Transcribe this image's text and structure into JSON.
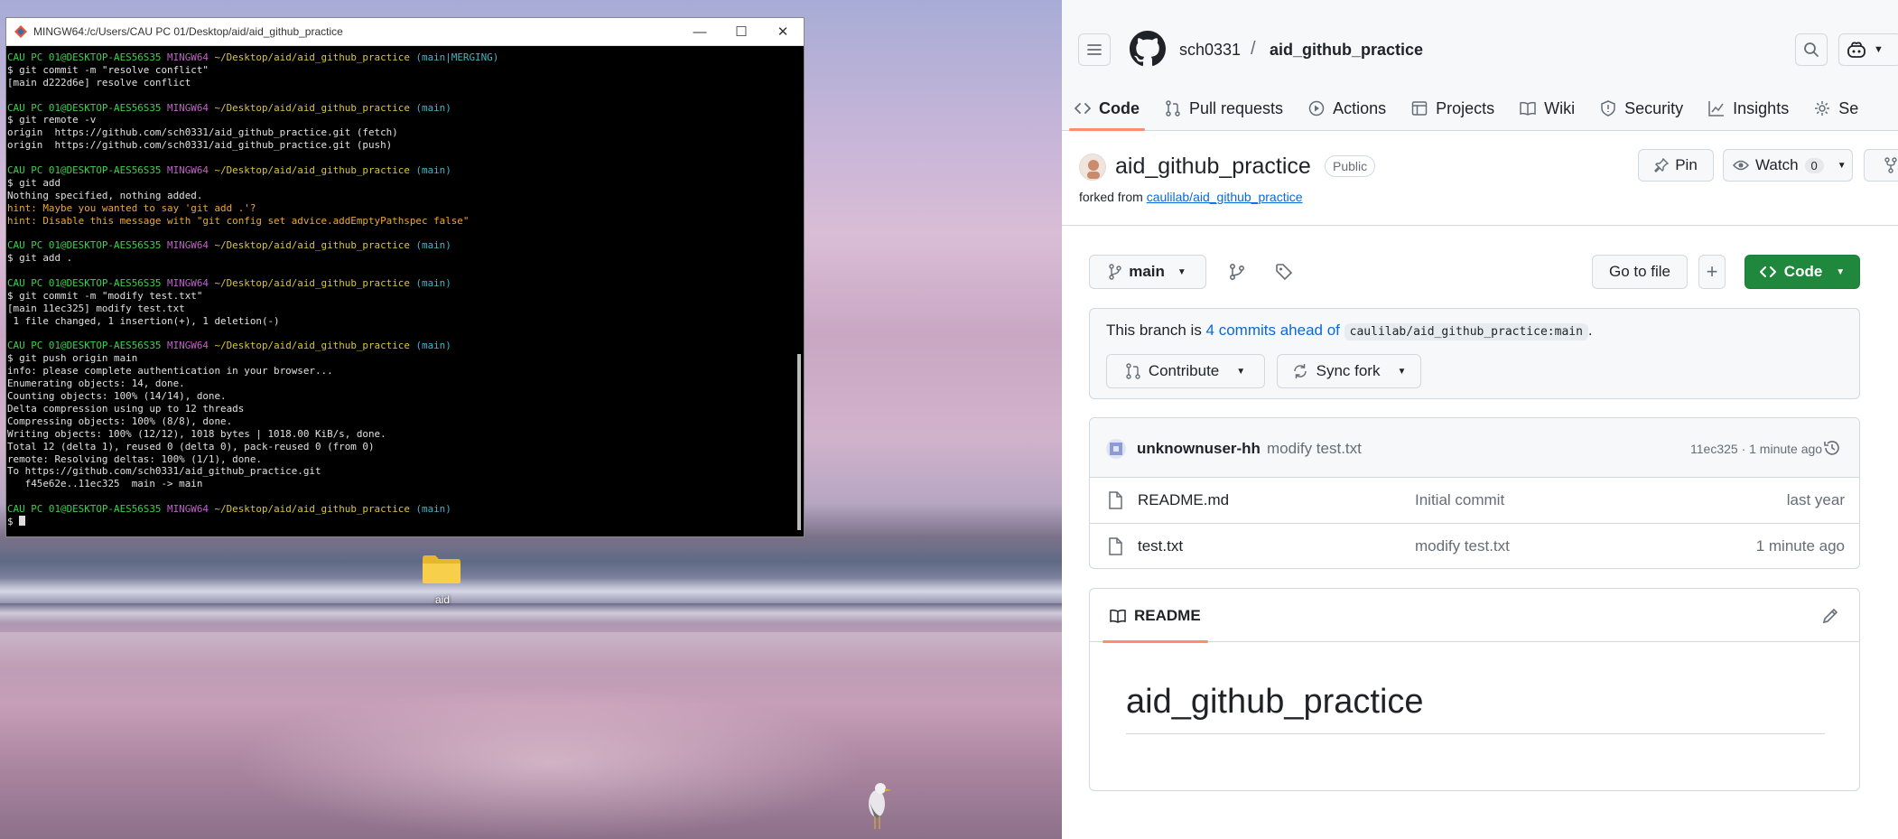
{
  "terminal": {
    "title": "MINGW64:/c/Users/CAU PC 01/Desktop/aid/aid_github_practice",
    "lines": [
      [
        {
          "t": "CAU PC 01@DESKTOP-AES56S35 ",
          "c": "g"
        },
        {
          "t": "MINGW64 ",
          "c": "p"
        },
        {
          "t": "~/Desktop/aid/aid_github_practice ",
          "c": "y"
        },
        {
          "t": "(main|MERGING)",
          "c": "c"
        }
      ],
      [
        {
          "t": "$ git commit -m \"resolve conflict\"",
          "c": "w"
        }
      ],
      [
        {
          "t": "[main d222d6e] resolve conflict",
          "c": "w"
        }
      ],
      [
        {
          "t": "",
          "c": "w"
        }
      ],
      [
        {
          "t": "CAU PC 01@DESKTOP-AES56S35 ",
          "c": "g"
        },
        {
          "t": "MINGW64 ",
          "c": "p"
        },
        {
          "t": "~/Desktop/aid/aid_github_practice ",
          "c": "y"
        },
        {
          "t": "(main)",
          "c": "c"
        }
      ],
      [
        {
          "t": "$ git remote -v",
          "c": "w"
        }
      ],
      [
        {
          "t": "origin  https://github.com/sch0331/aid_github_practice.git (fetch)",
          "c": "w"
        }
      ],
      [
        {
          "t": "origin  https://github.com/sch0331/aid_github_practice.git (push)",
          "c": "w"
        }
      ],
      [
        {
          "t": "",
          "c": "w"
        }
      ],
      [
        {
          "t": "CAU PC 01@DESKTOP-AES56S35 ",
          "c": "g"
        },
        {
          "t": "MINGW64 ",
          "c": "p"
        },
        {
          "t": "~/Desktop/aid/aid_github_practice ",
          "c": "y"
        },
        {
          "t": "(main)",
          "c": "c"
        }
      ],
      [
        {
          "t": "$ git add",
          "c": "w"
        }
      ],
      [
        {
          "t": "Nothing specified, nothing added.",
          "c": "w"
        }
      ],
      [
        {
          "t": "hint: Maybe you wanted to say 'git add .'?",
          "c": "o"
        }
      ],
      [
        {
          "t": "hint: Disable this message with \"git config set advice.addEmptyPathspec false\"",
          "c": "o"
        }
      ],
      [
        {
          "t": "",
          "c": "w"
        }
      ],
      [
        {
          "t": "CAU PC 01@DESKTOP-AES56S35 ",
          "c": "g"
        },
        {
          "t": "MINGW64 ",
          "c": "p"
        },
        {
          "t": "~/Desktop/aid/aid_github_practice ",
          "c": "y"
        },
        {
          "t": "(main)",
          "c": "c"
        }
      ],
      [
        {
          "t": "$ git add .",
          "c": "w"
        }
      ],
      [
        {
          "t": "",
          "c": "w"
        }
      ],
      [
        {
          "t": "CAU PC 01@DESKTOP-AES56S35 ",
          "c": "g"
        },
        {
          "t": "MINGW64 ",
          "c": "p"
        },
        {
          "t": "~/Desktop/aid/aid_github_practice ",
          "c": "y"
        },
        {
          "t": "(main)",
          "c": "c"
        }
      ],
      [
        {
          "t": "$ git commit -m \"modify test.txt\"",
          "c": "w"
        }
      ],
      [
        {
          "t": "[main 11ec325] modify test.txt",
          "c": "w"
        }
      ],
      [
        {
          "t": " 1 file changed, 1 insertion(+), 1 deletion(-)",
          "c": "w"
        }
      ],
      [
        {
          "t": "",
          "c": "w"
        }
      ],
      [
        {
          "t": "CAU PC 01@DESKTOP-AES56S35 ",
          "c": "g"
        },
        {
          "t": "MINGW64 ",
          "c": "p"
        },
        {
          "t": "~/Desktop/aid/aid_github_practice ",
          "c": "y"
        },
        {
          "t": "(main)",
          "c": "c"
        }
      ],
      [
        {
          "t": "$ git push origin main",
          "c": "w"
        }
      ],
      [
        {
          "t": "info: please complete authentication in your browser...",
          "c": "w"
        }
      ],
      [
        {
          "t": "Enumerating objects: 14, done.",
          "c": "w"
        }
      ],
      [
        {
          "t": "Counting objects: 100% (14/14), done.",
          "c": "w"
        }
      ],
      [
        {
          "t": "Delta compression using up to 12 threads",
          "c": "w"
        }
      ],
      [
        {
          "t": "Compressing objects: 100% (8/8), done.",
          "c": "w"
        }
      ],
      [
        {
          "t": "Writing objects: 100% (12/12), 1018 bytes | 1018.00 KiB/s, done.",
          "c": "w"
        }
      ],
      [
        {
          "t": "Total 12 (delta 1), reused 0 (delta 0), pack-reused 0 (from 0)",
          "c": "w"
        }
      ],
      [
        {
          "t": "remote: Resolving deltas: 100% (1/1), done.",
          "c": "w"
        }
      ],
      [
        {
          "t": "To https://github.com/sch0331/aid_github_practice.git",
          "c": "w"
        }
      ],
      [
        {
          "t": "   f45e62e..11ec325  main -> main",
          "c": "w"
        }
      ],
      [
        {
          "t": "",
          "c": "w"
        }
      ],
      [
        {
          "t": "CAU PC 01@DESKTOP-AES56S35 ",
          "c": "g"
        },
        {
          "t": "MINGW64 ",
          "c": "p"
        },
        {
          "t": "~/Desktop/aid/aid_github_practice ",
          "c": "y"
        },
        {
          "t": "(main)",
          "c": "c"
        }
      ],
      [
        {
          "t": "$ ",
          "c": "w"
        }
      ]
    ],
    "colors": {
      "g": "#3bd14a",
      "p": "#c061cb",
      "y": "#d7c43a",
      "c": "#3fb6c8",
      "o": "#e6a93b"
    }
  },
  "desktop": {
    "folder_label": "aid"
  },
  "github": {
    "owner": "sch0331",
    "separator": "/",
    "repo": "aid_github_practice",
    "tabs": [
      {
        "label": "Code",
        "icon": "code-icon"
      },
      {
        "label": "Pull requests",
        "icon": "pull-request-icon"
      },
      {
        "label": "Actions",
        "icon": "play-icon"
      },
      {
        "label": "Projects",
        "icon": "table-icon"
      },
      {
        "label": "Wiki",
        "icon": "book-icon"
      },
      {
        "label": "Security",
        "icon": "shield-icon"
      },
      {
        "label": "Insights",
        "icon": "graph-icon"
      },
      {
        "label": "Se",
        "icon": "gear-icon"
      }
    ],
    "repo_title": "aid_github_practice",
    "visibility": "Public",
    "forked_prefix": "forked from ",
    "forked_link": "caulilab/aid_github_practice",
    "pin_label": "Pin",
    "watch_label": "Watch",
    "watch_count": "0",
    "branch": "main",
    "go_to_file": "Go to file",
    "code_button": "Code",
    "ahead": {
      "prefix": "This branch is ",
      "link": "4 commits ahead of",
      "ref": "caulilab/aid_github_practice:main",
      "suffix": "."
    },
    "contribute_label": "Contribute",
    "sync_label": "Sync fork",
    "latest_commit": {
      "user": "unknownuser-hh",
      "message": "modify test.txt",
      "meta": "11ec325 · 1 minute ago"
    },
    "files": [
      {
        "name": "README.md",
        "message": "Initial commit",
        "date": "last year"
      },
      {
        "name": "test.txt",
        "message": "modify test.txt",
        "date": "1 minute ago"
      }
    ],
    "readme_tab": "README",
    "readme_heading": "aid_github_practice",
    "accent": "#fd8c73",
    "green": "#1f883d",
    "link": "#0969da"
  }
}
